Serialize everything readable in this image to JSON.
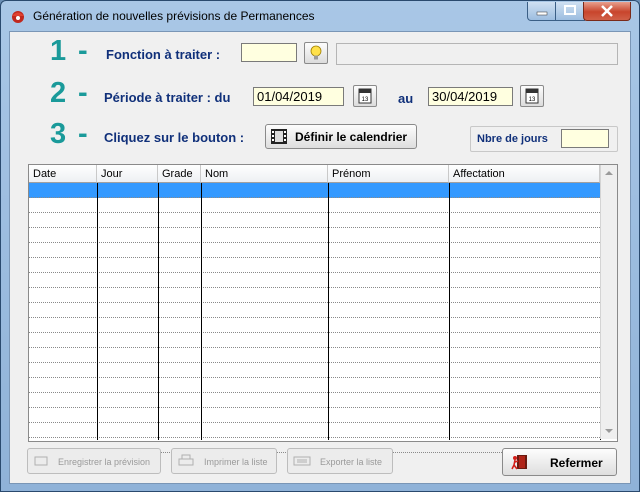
{
  "window": {
    "title": "Génération de nouvelles prévisions de Permanences",
    "icon": "app-icon"
  },
  "steps": {
    "step1": {
      "number": "1",
      "dash": "-",
      "label": "Fonction à traiter :",
      "value": "",
      "description": ""
    },
    "step2": {
      "number": "2",
      "dash": "-",
      "label": "Période à traiter : du",
      "from": "01/04/2019",
      "to_label": "au",
      "to": "30/04/2019"
    },
    "step3": {
      "number": "3",
      "dash": "-",
      "label": "Cliquez sur le bouton :",
      "button": "Définir le calendrier",
      "days_label": "Nbre de jours",
      "days_value": ""
    }
  },
  "grid": {
    "columns": [
      "Date",
      "Jour",
      "Grade",
      "Nom",
      "Prénom",
      "Affectation"
    ],
    "selected_row": 0,
    "rows": 18
  },
  "footer": {
    "save": "Enregistrer la prévision",
    "print": "Imprimer la liste",
    "export": "Exporter la liste",
    "close": "Refermer"
  },
  "colors": {
    "step_number": "#1a9a9a",
    "step_label": "#10307a",
    "selection": "#3399ff",
    "input_bg": "#ffffe0"
  }
}
